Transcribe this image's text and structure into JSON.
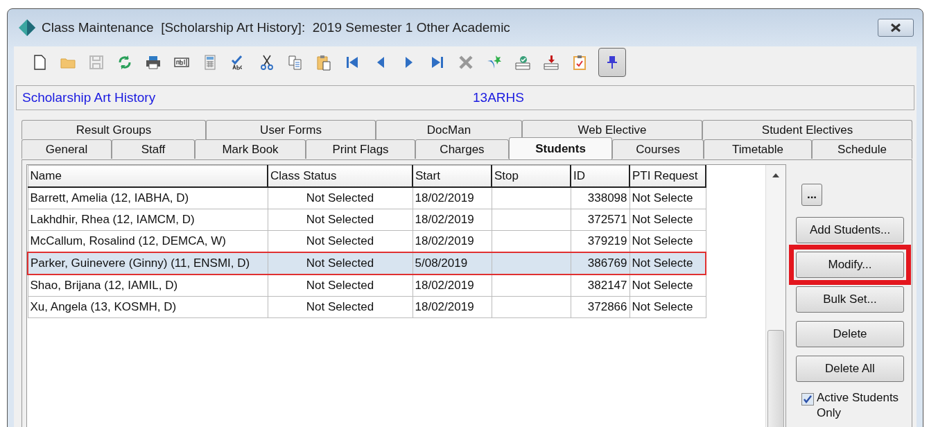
{
  "window": {
    "title": "Class Maintenance  [Scholarship Art History]:  2019 Semester 1 Other Academic"
  },
  "toolbar": {
    "pin_selected": true
  },
  "header": {
    "class_name": "Scholarship Art History",
    "class_code": "13ARHS"
  },
  "tab_rows": [
    [
      {
        "label": "Result Groups",
        "selected": false
      },
      {
        "label": "User Forms",
        "selected": false
      },
      {
        "label": "DocMan",
        "selected": false
      },
      {
        "label": "Web Elective",
        "selected": false
      },
      {
        "label": "Student Electives",
        "selected": false
      }
    ],
    [
      {
        "label": "General",
        "selected": false
      },
      {
        "label": "Staff",
        "selected": false
      },
      {
        "label": "Mark Book",
        "selected": false
      },
      {
        "label": "Print Flags",
        "selected": false
      },
      {
        "label": "Charges",
        "selected": false
      },
      {
        "label": "Students",
        "selected": true
      },
      {
        "label": "Courses",
        "selected": false
      },
      {
        "label": "Timetable",
        "selected": false
      },
      {
        "label": "Schedule",
        "selected": false
      }
    ]
  ],
  "table": {
    "columns": [
      "Name",
      "Class Status",
      "Start",
      "Stop",
      "ID",
      "PTI Request"
    ],
    "rows": [
      {
        "cells": [
          "Barrett, Amelia (12, IABHA, D)",
          "Not Selected",
          "18/02/2019",
          "",
          "338098",
          "Not Selecte"
        ],
        "selected": false
      },
      {
        "cells": [
          "Lakhdhir, Rhea (12, IAMCM, D)",
          "Not Selected",
          "18/02/2019",
          "",
          "372571",
          "Not Selecte"
        ],
        "selected": false
      },
      {
        "cells": [
          "McCallum, Rosalind (12, DEMCA, W)",
          "Not Selected",
          "18/02/2019",
          "",
          "379219",
          "Not Selecte"
        ],
        "selected": false
      },
      {
        "cells": [
          "Parker, Guinevere (Ginny) (11, ENSMI, D)",
          "Not Selected",
          "5/08/2019",
          "",
          "386769",
          "Not Selecte"
        ],
        "selected": true
      },
      {
        "cells": [
          "Shao, Brijana (12, IAMIL, D)",
          "Not Selected",
          "18/02/2019",
          "",
          "382147",
          "Not Selecte"
        ],
        "selected": false
      },
      {
        "cells": [
          "Xu, Angela (13, KOSMH, D)",
          "Not Selected",
          "18/02/2019",
          "",
          "372866",
          "Not Selecte"
        ],
        "selected": false
      }
    ]
  },
  "side_buttons": [
    {
      "label": "...",
      "kind": "small"
    },
    {
      "label": "Add Students...",
      "kind": "wide",
      "highlighted": false
    },
    {
      "label": "Modify...",
      "kind": "wide",
      "highlighted": true
    },
    {
      "label": "Bulk Set...",
      "kind": "wide",
      "highlighted": false
    },
    {
      "label": "Delete",
      "kind": "wide",
      "highlighted": false
    },
    {
      "label": "Delete All",
      "kind": "wide",
      "highlighted": false
    }
  ],
  "active_only": {
    "label": "Active Students Only",
    "checked": true
  }
}
